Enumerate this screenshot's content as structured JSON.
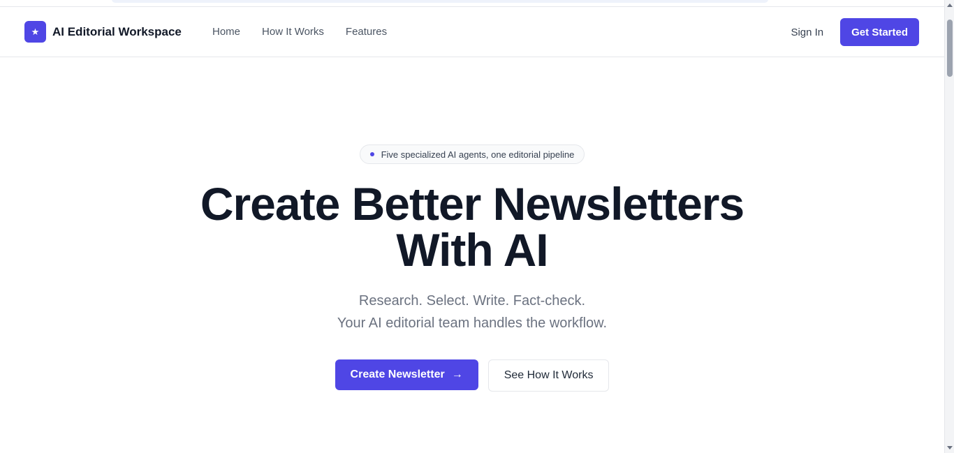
{
  "brand": {
    "name": "AI Editorial Workspace",
    "logo_icon": "star-icon"
  },
  "nav": {
    "links": [
      "Home",
      "How It Works",
      "Features"
    ],
    "sign_in": "Sign In",
    "get_started": "Get Started"
  },
  "hero": {
    "badge": "Five specialized AI agents, one editorial pipeline",
    "headline_line1": "Create Better Newsletters",
    "headline_line2": "With AI",
    "sub_line1": "Research. Select. Write. Fact-check.",
    "sub_line2": "Your AI editorial team handles the workflow.",
    "primary_cta": "Create Newsletter",
    "primary_cta_icon": "arrow-right-icon",
    "secondary_cta": "See How It Works"
  },
  "colors": {
    "accent": "#4f46e5",
    "text": "#111827",
    "muted": "#6b7280"
  }
}
